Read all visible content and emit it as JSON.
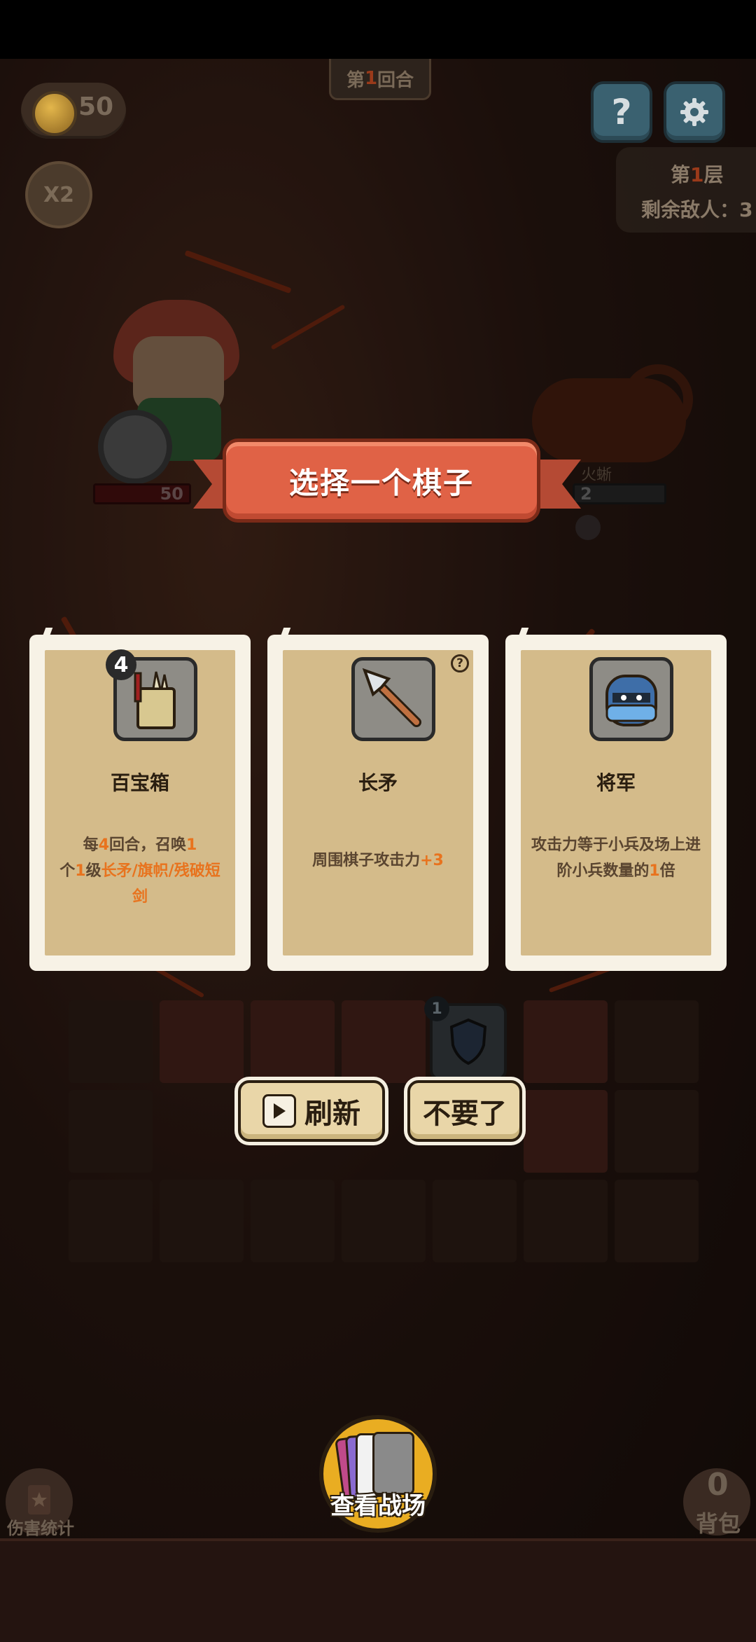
{
  "hud": {
    "coins": "50",
    "speed": "X2",
    "round_prefix": "第",
    "round_number": "1",
    "round_suffix": "回合",
    "help_label": "?",
    "floor_prefix": "第",
    "floor_number": "1",
    "floor_suffix": "层",
    "enemies_left": "剩余敌人：3"
  },
  "battle": {
    "hero_hp": "50",
    "enemy_name": "火蜥",
    "enemy_value": "2"
  },
  "dialog": {
    "title": "选择一个棋子",
    "cards": [
      {
        "level": "4",
        "name": "百宝箱",
        "desc_parts": [
          "每",
          "4",
          "回合，召唤",
          "1",
          "个",
          "1",
          "级",
          "长矛/旗帜/残破短剑"
        ]
      },
      {
        "name": "长矛",
        "help": "?",
        "desc_parts": [
          "周围棋子攻击力",
          "+3"
        ]
      },
      {
        "name": "将军",
        "desc_parts": [
          "攻击力等于小兵及场上进阶小兵数量的",
          "1",
          "倍"
        ]
      }
    ],
    "refresh_label": "刷新",
    "skip_label": "不要了"
  },
  "board": {
    "piece_level": "1"
  },
  "bottom": {
    "damage_stats_label": "伤害统计",
    "view_battlefield_label": "查看战场",
    "backpack_count": "0",
    "backpack_label": "背包"
  },
  "colors": {
    "banner": "#e06246",
    "card_bg": "#d4bb8a",
    "highlight": "#e8731e",
    "button": "#e9d6a8",
    "battle_button": "#e9ad22"
  }
}
